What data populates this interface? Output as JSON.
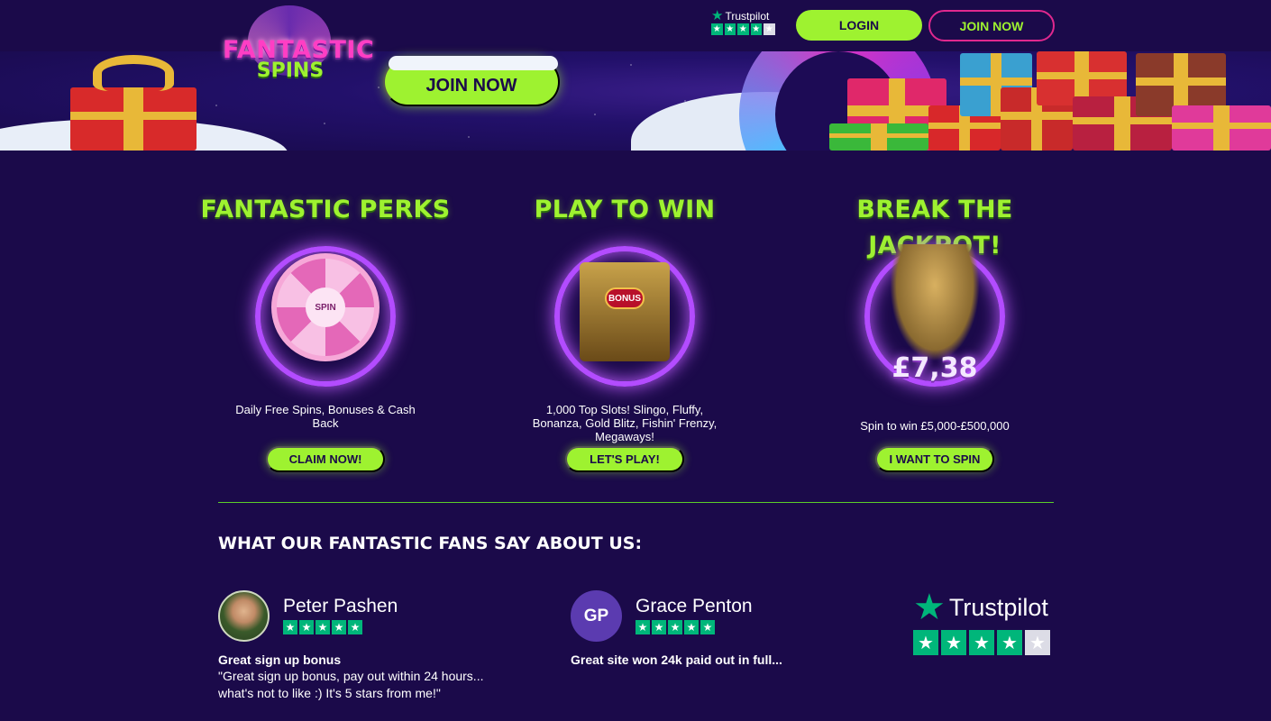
{
  "header": {
    "logo_line1": "FANTASTIC",
    "logo_line2": "SPINS",
    "trustpilot_label": "Trustpilot",
    "login_label": "LOGIN",
    "join_label": "JOIN NOW"
  },
  "banner": {
    "join_label": "JOIN NOW"
  },
  "perks": [
    {
      "title": "FANTASTIC PERKS",
      "wheel_center": "SPIN",
      "description": "Daily Free Spins, Bonuses & Cash Back",
      "button": "CLAIM NOW!"
    },
    {
      "title": "PLAY TO WIN",
      "badge": "BONUS",
      "description": "1,000 Top Slots! Slingo, Fluffy, Bonanza, Gold Blitz, Fishin' Frenzy, Megaways!",
      "button": "LET'S PLAY!"
    },
    {
      "title": "BREAK THE JACKPOT!",
      "jackpot": "£7,38",
      "description": "Spin to win £5,000-£500,000",
      "button": "I WANT TO SPIN"
    }
  ],
  "reviews": {
    "heading": "WHAT OUR FANTASTIC FANS SAY ABOUT US:",
    "items": [
      {
        "name": "Peter Pashen",
        "title": "Great sign up bonus",
        "body": "\"Great sign up bonus, pay out within 24 hours... what's not to like :) It's 5 stars from me!\""
      },
      {
        "name": "Grace Penton",
        "initials": "GP",
        "title": "Great site won 24k paid out in full...",
        "body": ""
      }
    ],
    "trustpilot_label": "Trustpilot"
  },
  "colors": {
    "background": "#1b0a4a",
    "accent_green": "#9ef230",
    "accent_pink": "#e0288e",
    "trustpilot_green": "#00b67a"
  },
  "icons": [
    "trustpilot-star-icon",
    "gift-icon",
    "wheel-icon"
  ]
}
